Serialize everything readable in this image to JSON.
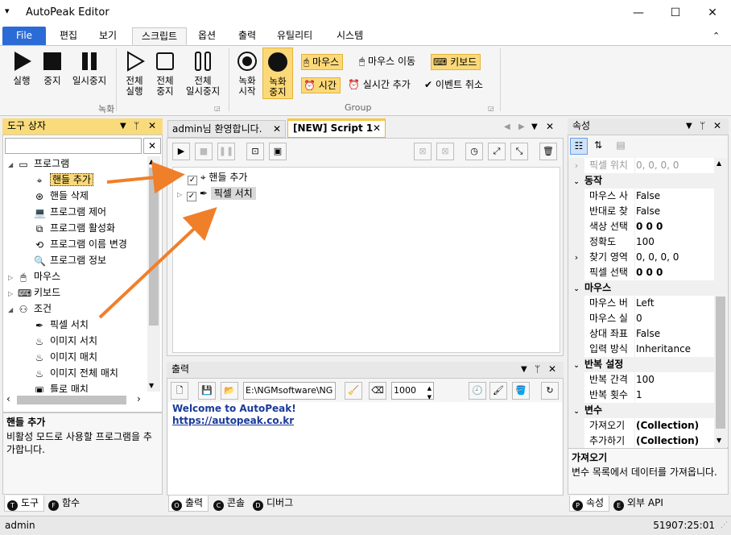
{
  "window": {
    "title": "AutoPeak Editor",
    "minimize": "—",
    "maximize": "☐",
    "close": "✕"
  },
  "menu": {
    "file": "File",
    "tabs": [
      "편집",
      "보기",
      "스크립트",
      "옵션",
      "출력",
      "유틸리티",
      "시스템"
    ],
    "active": "스크립트",
    "collapse": "⌃"
  },
  "ribbon": {
    "run": "실행",
    "stop": "중지",
    "pause": "일시중지",
    "run_all": [
      "전체",
      "실행"
    ],
    "stop_all": [
      "전체",
      "중지"
    ],
    "pause_all": [
      "전체",
      "일시중지"
    ],
    "group1": "녹화",
    "rec_start": [
      "녹화",
      "시작"
    ],
    "rec_stop": [
      "녹화",
      "중지"
    ],
    "mouse": "마우스",
    "mouse_move": "마우스 이동",
    "keyboard": "키보드",
    "time": "시간",
    "realtime_add": "실시간 추가",
    "event_cancel": "이벤트 취소",
    "group2": "Group"
  },
  "toolbox": {
    "title": "도구 상자",
    "search_value": "",
    "clear": "✕",
    "items": [
      {
        "label": "프로그램",
        "icon": "program-icon",
        "level": 0,
        "expander": "◢"
      },
      {
        "label": "핸들 추가",
        "icon": "crosshair-icon",
        "level": 1,
        "selected": true
      },
      {
        "label": "핸들 삭제",
        "icon": "handle-remove-icon",
        "level": 1
      },
      {
        "label": "프로그램 제어",
        "icon": "laptop-icon",
        "level": 1
      },
      {
        "label": "프로그램 활성화",
        "icon": "activate-icon",
        "level": 1
      },
      {
        "label": "프로그램 이름 변경",
        "icon": "rename-icon",
        "level": 1
      },
      {
        "label": "프로그램 정보",
        "icon": "search-icon",
        "level": 1
      },
      {
        "label": "마우스",
        "icon": "mouse-icon",
        "level": 0,
        "expander": "▷"
      },
      {
        "label": "키보드",
        "icon": "keyboard-icon",
        "level": 0,
        "expander": "▷"
      },
      {
        "label": "조건",
        "icon": "condition-icon",
        "level": 0,
        "expander": "◢"
      },
      {
        "label": "픽셀 서치",
        "icon": "eyedropper-icon",
        "level": 1
      },
      {
        "label": "이미지 서치",
        "icon": "image-search-icon",
        "level": 1
      },
      {
        "label": "이미지 매치",
        "icon": "image-match-icon",
        "level": 1
      },
      {
        "label": "이미지 전체 매치",
        "icon": "image-all-icon",
        "level": 1
      },
      {
        "label": "틀로 매치",
        "icon": "frame-icon",
        "level": 1
      }
    ],
    "desc_title": "핸들 추가",
    "desc_text": "비활성 모드로 사용할 프로그램을 추가합니다.",
    "tabs": [
      {
        "badge": "T",
        "label": "도구"
      },
      {
        "badge": "F",
        "label": "함수"
      }
    ]
  },
  "editor": {
    "tabs": [
      {
        "label": "admin님 환영합니다.",
        "close": "✕"
      },
      {
        "label": "[NEW] Script 1",
        "close": "✕"
      }
    ],
    "nodes": [
      {
        "label": "핸들 추가",
        "icon": "crosshair-icon",
        "checked": true
      },
      {
        "label": "픽셀 서치",
        "icon": "eyedropper-icon",
        "checked": true,
        "expander": "▷"
      }
    ]
  },
  "output": {
    "title": "출력",
    "path": "E:\\NGMsoftware\\NG",
    "number": "1000",
    "lines": [
      "Welcome to AutoPeak!",
      "https://autopeak.co.kr"
    ],
    "tabs": [
      {
        "badge": "O",
        "label": "출력"
      },
      {
        "badge": "C",
        "label": "콘솔"
      },
      {
        "badge": "D",
        "label": "디버그"
      }
    ]
  },
  "properties": {
    "title": "속성",
    "rows": [
      {
        "type": "prop",
        "expander": "›",
        "name": "픽셀 위치",
        "value": "0, 0, 0, 0",
        "faded": true
      },
      {
        "type": "cat",
        "name": "동작"
      },
      {
        "type": "prop",
        "name": "마우스 사",
        "value": "False"
      },
      {
        "type": "prop",
        "name": "반대로 찾",
        "value": "False"
      },
      {
        "type": "prop",
        "name": "색상 선택",
        "value": "0 0 0",
        "bold": true
      },
      {
        "type": "prop",
        "name": "정확도",
        "value": "100"
      },
      {
        "type": "prop",
        "expander": "›",
        "name": "찾기 영역",
        "value": "0, 0, 0, 0"
      },
      {
        "type": "prop",
        "name": "픽셀 선택",
        "value": "0 0 0",
        "bold": true
      },
      {
        "type": "cat",
        "name": "마우스"
      },
      {
        "type": "prop",
        "name": "마우스 버",
        "value": "Left"
      },
      {
        "type": "prop",
        "name": "마우스 실",
        "value": "0"
      },
      {
        "type": "prop",
        "name": "상대 좌표",
        "value": "False"
      },
      {
        "type": "prop",
        "name": "입력 방식",
        "value": "Inheritance"
      },
      {
        "type": "cat",
        "name": "반복 설정"
      },
      {
        "type": "prop",
        "name": "반복 간격",
        "value": "100"
      },
      {
        "type": "prop",
        "name": "반복 횟수",
        "value": "1"
      },
      {
        "type": "cat",
        "name": "변수"
      },
      {
        "type": "prop",
        "name": "가져오기",
        "value": "(Collection)",
        "bold": true
      },
      {
        "type": "prop",
        "name": "추가하기",
        "value": "(Collection)",
        "bold": true
      }
    ],
    "desc_title": "가져오기",
    "desc_text": "변수 목록에서 데이터를 가져옵니다.",
    "tabs": [
      {
        "badge": "P",
        "label": "속성"
      },
      {
        "badge": "E",
        "label": "외부 API"
      }
    ]
  },
  "status": {
    "user": "admin",
    "time": "51907:25:01"
  },
  "colors": {
    "accent": "#2b6bd6",
    "panel_header": "#f9db7c",
    "highlight": "#fcd978",
    "arrow": "#f07f2a",
    "link": "#1a3a9a"
  }
}
